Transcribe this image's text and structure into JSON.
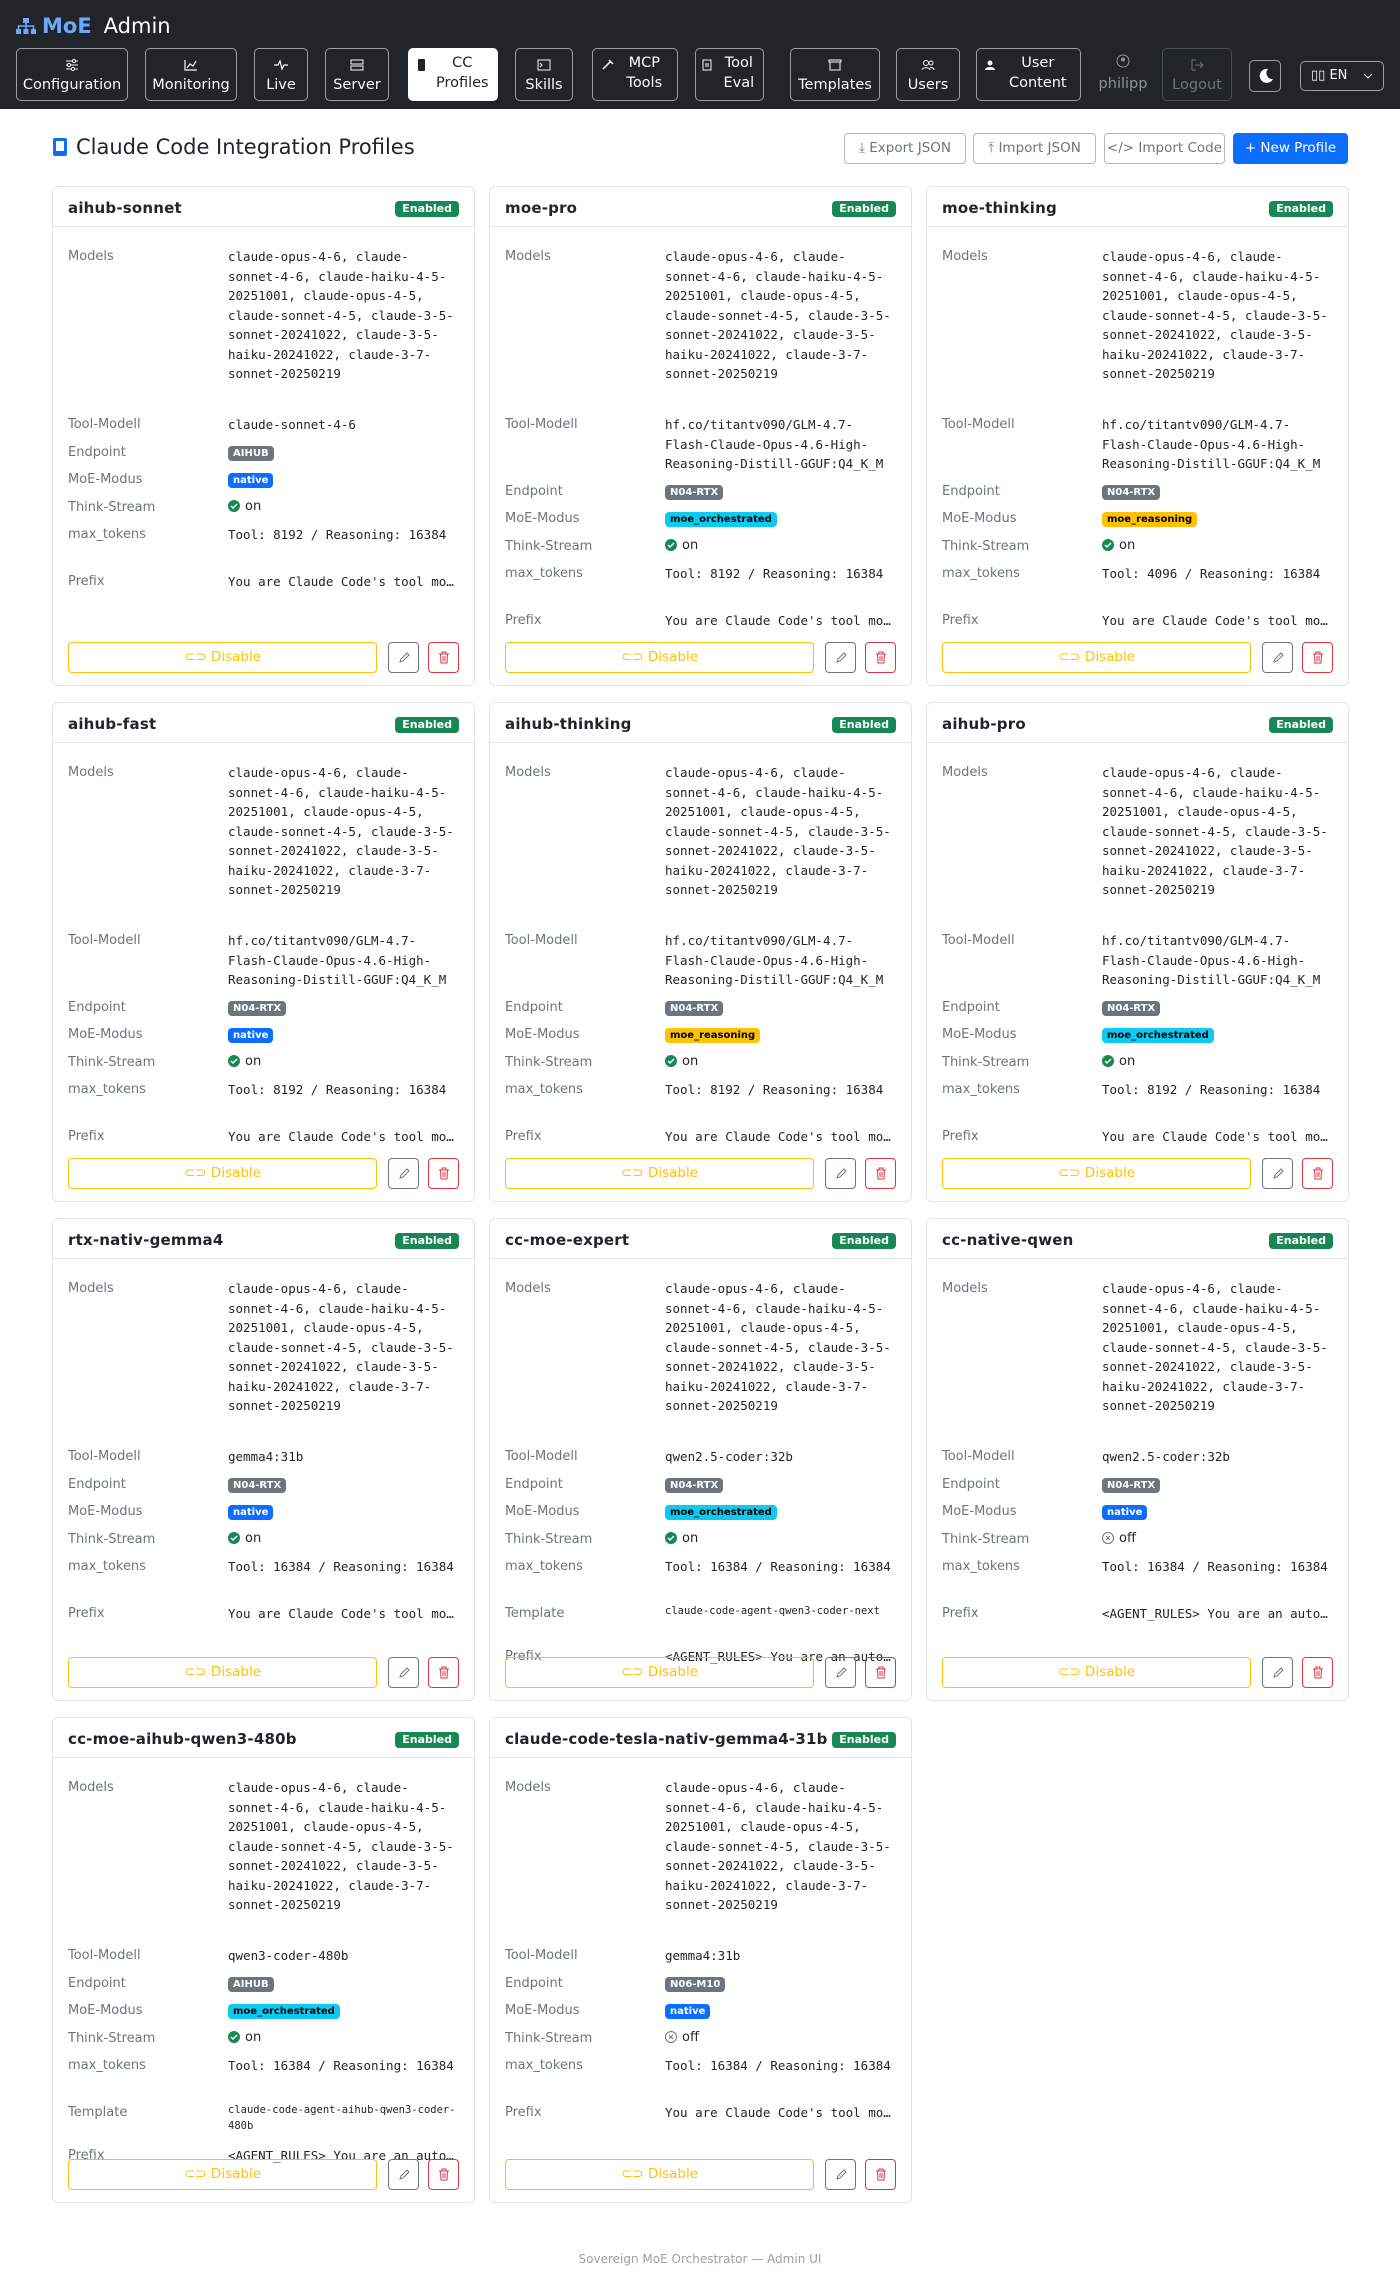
{
  "navbar": {
    "brand": "MoE",
    "brand_suffix": "Admin",
    "items": [
      {
        "label": "Configuration",
        "icon": "sliders-icon"
      },
      {
        "label": "Monitoring",
        "icon": "chart-icon"
      },
      {
        "label": "Live",
        "icon": "pulse-icon"
      },
      {
        "label": "Server",
        "icon": "server-icon"
      },
      {
        "label": "CC Profiles",
        "icon": "terminal-icon",
        "active": true
      },
      {
        "label": "Skills",
        "icon": "terminal-icon"
      },
      {
        "label": "MCP Tools",
        "icon": "tools-icon"
      },
      {
        "label": "Tool Eval",
        "icon": "clipboard-icon"
      },
      {
        "label": "Templates",
        "icon": "box-icon"
      },
      {
        "label": "Users",
        "icon": "users-icon"
      },
      {
        "label": "User Content",
        "icon": "user-icon"
      }
    ],
    "username": "philipp",
    "logout": "Logout",
    "language": "EN"
  },
  "page": {
    "title": "Claude Code Integration Profiles",
    "buttons": {
      "export": "Export JSON",
      "import_json": "Import JSON",
      "import_code": "Import Code",
      "new_profile": "+ New Profile"
    }
  },
  "labels": {
    "models": "Models",
    "tool_model": "Tool-Modell",
    "endpoint": "Endpoint",
    "moe_mode": "MoE-Modus",
    "think_stream": "Think-Stream",
    "max_tokens": "max_tokens",
    "template": "Template",
    "prefix": "Prefix",
    "enabled": "Enabled",
    "disable": "Disable"
  },
  "models_list": "claude-opus-4-6, claude-sonnet-4-6, claude-haiku-4-5-20251001, claude-opus-4-5, claude-sonnet-4-5, claude-3-5-sonnet-20241022, claude-3-5-haiku-20241022, claude-3-7-sonnet-20250219",
  "profiles": [
    {
      "name": "aihub-sonnet",
      "tool_model": "claude-sonnet-4-6",
      "endpoint": "AIHUB",
      "moe_mode": "native",
      "think_stream": "on",
      "max_tokens": "Tool: 8192 / Reasoning: 16384",
      "prefix": "You are Claude Code's tool model. Follow the instructions exactly."
    },
    {
      "name": "moe-pro",
      "tool_model": "hf.co/titantv090/GLM-4.7-Flash-Claude-Opus-4.6-High-Reasoning-Distill-GGUF:Q4_K_M",
      "endpoint": "N04-RTX",
      "moe_mode": "moe_orchestrated",
      "think_stream": "on",
      "max_tokens": "Tool: 8192 / Reasoning: 16384",
      "prefix": "You are Claude Code's tool model. Follow the instructions exactly."
    },
    {
      "name": "moe-thinking",
      "tool_model": "hf.co/titantv090/GLM-4.7-Flash-Claude-Opus-4.6-High-Reasoning-Distill-GGUF:Q4_K_M",
      "endpoint": "N04-RTX",
      "moe_mode": "moe_reasoning",
      "think_stream": "on",
      "max_tokens": "Tool: 4096 / Reasoning: 16384",
      "prefix": "You are Claude Code's tool model. Follow the instructions exactly."
    },
    {
      "name": "aihub-fast",
      "tool_model": "hf.co/titantv090/GLM-4.7-Flash-Claude-Opus-4.6-High-Reasoning-Distill-GGUF:Q4_K_M",
      "endpoint": "N04-RTX",
      "moe_mode": "native",
      "think_stream": "on",
      "max_tokens": "Tool: 8192 / Reasoning: 16384",
      "prefix": "You are Claude Code's tool model. Follow the instructions exactly."
    },
    {
      "name": "aihub-thinking",
      "tool_model": "hf.co/titantv090/GLM-4.7-Flash-Claude-Opus-4.6-High-Reasoning-Distill-GGUF:Q4_K_M",
      "endpoint": "N04-RTX",
      "moe_mode": "moe_reasoning",
      "think_stream": "on",
      "max_tokens": "Tool: 8192 / Reasoning: 16384",
      "prefix": "You are Claude Code's tool model. Follow the instructions exactly."
    },
    {
      "name": "aihub-pro",
      "tool_model": "hf.co/titantv090/GLM-4.7-Flash-Claude-Opus-4.6-High-Reasoning-Distill-GGUF:Q4_K_M",
      "endpoint": "N04-RTX",
      "moe_mode": "moe_orchestrated",
      "think_stream": "on",
      "max_tokens": "Tool: 8192 / Reasoning: 16384",
      "prefix": "You are Claude Code's tool model. Follow the instructions exactly."
    },
    {
      "name": "rtx-nativ-gemma4",
      "tool_model": "gemma4:31b",
      "endpoint": "N04-RTX",
      "moe_mode": "native",
      "think_stream": "on",
      "max_tokens": "Tool: 16384 / Reasoning: 16384",
      "prefix": "You are Claude Code's tool model. Follow the instructions exactly."
    },
    {
      "name": "cc-moe-expert",
      "tool_model": "qwen2.5-coder:32b",
      "endpoint": "N04-RTX",
      "moe_mode": "moe_orchestrated",
      "think_stream": "on",
      "max_tokens": "Tool: 16384 / Reasoning: 16384",
      "template": "claude-code-agent-qwen3-coder-next",
      "prefix": "<AGENT_RULES> You are an autonomous coding agent."
    },
    {
      "name": "cc-native-qwen",
      "tool_model": "qwen2.5-coder:32b",
      "endpoint": "N04-RTX",
      "moe_mode": "native",
      "think_stream": "off",
      "max_tokens": "Tool: 16384 / Reasoning: 16384",
      "prefix": "<AGENT_RULES> You are an autonomous coding agent."
    },
    {
      "name": "cc-moe-aihub-qwen3-480b",
      "tool_model": "qwen3-coder-480b",
      "endpoint": "AIHUB",
      "moe_mode": "moe_orchestrated",
      "think_stream": "on",
      "max_tokens": "Tool: 16384 / Reasoning: 16384",
      "template": "claude-code-agent-aihub-qwen3-coder-480b",
      "prefix": "<AGENT_RULES> You are an autonomous coding agent."
    },
    {
      "name": "claude-code-tesla-nativ-gemma4-31b",
      "tool_model": "gemma4:31b",
      "endpoint": "N06-M10",
      "moe_mode": "native",
      "think_stream": "off",
      "max_tokens": "Tool: 16384 / Reasoning: 16384",
      "prefix": "You are Claude Code's tool model. Follow the instructions exactly."
    }
  ],
  "footer": "Sovereign MoE Orchestrator — Admin UI",
  "colors": {
    "navbar": "#212529",
    "primary": "#0d6efd",
    "success": "#198754",
    "warning": "#ffc107",
    "danger": "#dc3545",
    "info": "#0dcaf0",
    "secondary": "#6c757d"
  }
}
